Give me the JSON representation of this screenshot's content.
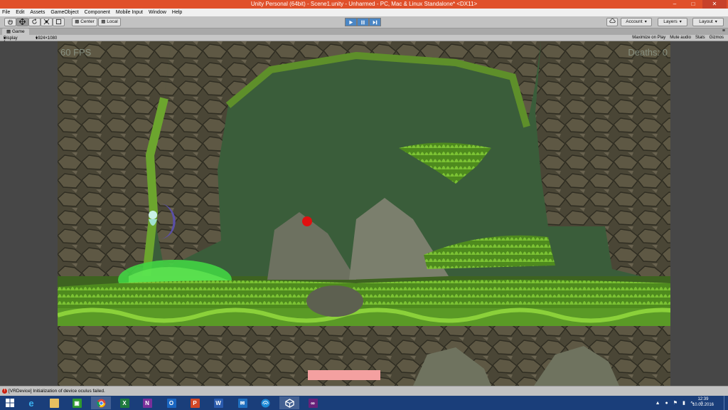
{
  "window": {
    "title": "Unity Personal (64bit) - Scene1.unity - Unharmed - PC, Mac & Linux Standalone* <DX11>",
    "minimize": "–",
    "maximize": "□",
    "close": "✕"
  },
  "menu": [
    "File",
    "Edit",
    "Assets",
    "GameObject",
    "Component",
    "Mobile Input",
    "Window",
    "Help"
  ],
  "toolbar": {
    "pivot_center": "Center",
    "pivot_local": "Local",
    "account": "Account",
    "layers": "Layers",
    "layout": "Layout"
  },
  "game_view": {
    "tab_label": "Game",
    "display": "Display 1",
    "resolution": "1924×1080",
    "maximize_on_play": "Maximize on Play",
    "mute_audio": "Mute audio",
    "stats": "Stats",
    "gizmos": "Gizmos"
  },
  "hud": {
    "fps": "60 FPS",
    "deaths": "Deaths: 0"
  },
  "console": {
    "message": "[VRDevice] Initialization of device oculus failed."
  },
  "taskbar": {
    "apps": [
      "windows-start",
      "internet-explorer",
      "file-explorer",
      "store",
      "chrome",
      "excel",
      "onenote",
      "outlook",
      "powerpoint",
      "word",
      "mail",
      "network",
      "unity",
      "visual-studio"
    ],
    "clock_time": "12:39",
    "clock_date": "10.02.2016"
  },
  "colors": {
    "title_bar": "#e0502a",
    "taskbar": "#1a3e7a",
    "play_active": "#4a86c5",
    "cave_background": "#3a5d3a",
    "red_dot": "#e01010",
    "pink_bar": "#f4a0a0"
  }
}
